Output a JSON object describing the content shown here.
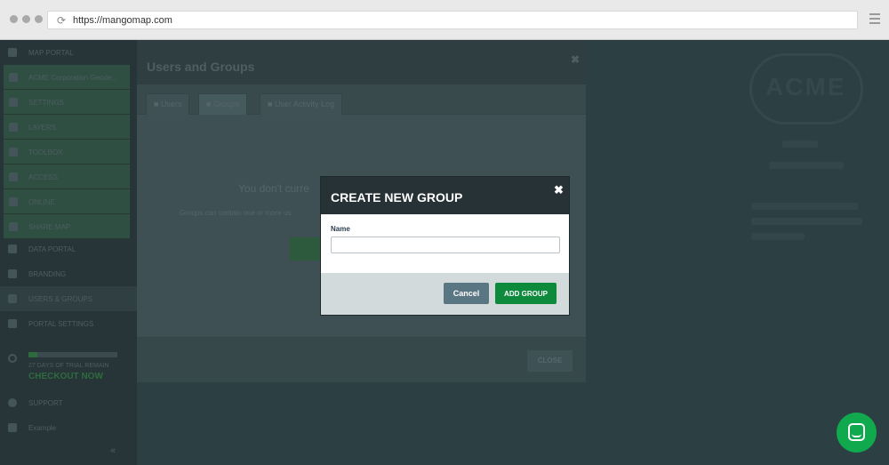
{
  "browser": {
    "url": "https://mangomap.com"
  },
  "sidebar": {
    "items": [
      {
        "label": "MAP PORTAL"
      },
      {
        "label": "ACME Corporation Geode..."
      },
      {
        "label": "SETTINGS"
      },
      {
        "label": "LAYERS"
      },
      {
        "label": "TOOLBOX"
      },
      {
        "label": "ACCESS"
      },
      {
        "label": "ONLINE"
      },
      {
        "label": "SHARE MAP"
      },
      {
        "label": "DATA PORTAL"
      },
      {
        "label": "BRANDING"
      },
      {
        "label": "USERS & GROUPS"
      },
      {
        "label": "PORTAL SETTINGS"
      }
    ],
    "trial": {
      "days_text": "27 DAYS OF TRIAL REMAIN",
      "checkout": "CHECKOUT NOW",
      "progress": 0.1
    },
    "support": "SUPPORT",
    "user": "Example",
    "collapse": "«"
  },
  "users_groups": {
    "title": "Users and Groups",
    "close_x": "✖",
    "tabs": [
      "Users",
      "Groups",
      "User Activity Log"
    ],
    "empty_title": "You don't curre",
    "empty_sub": "Groups can contain one or more us",
    "close_button": "CLOSE"
  },
  "map": {
    "logo": "ACME"
  },
  "dialog": {
    "title": "CREATE NEW GROUP",
    "close": "✖",
    "name_label": "Name",
    "name_value": "",
    "cancel": "Cancel",
    "add": "ADD GROUP"
  },
  "colors": {
    "accent": "#0e8a3c",
    "cancel": "#5a7682",
    "header": "#263235"
  }
}
